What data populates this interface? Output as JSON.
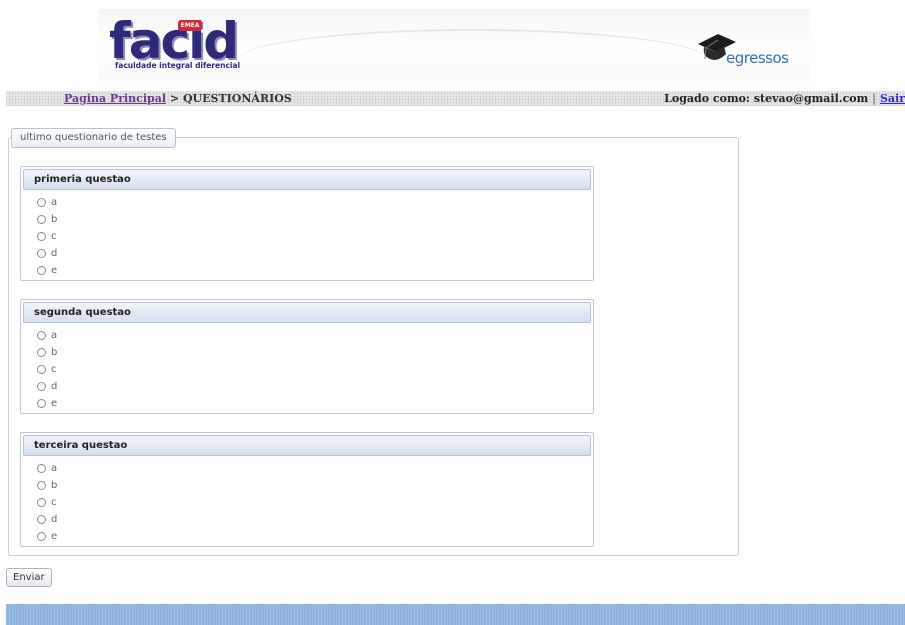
{
  "header": {
    "logo_facid": {
      "word": "facid",
      "badge": "EMEA",
      "tagline": "faculdade integral diferencial"
    },
    "logo_egressos": {
      "word": "egressos"
    }
  },
  "nav": {
    "home_link": "Pagina Principal",
    "separator": " > ",
    "current": "QUESTIONÁRIOS",
    "logged_as": "Logado como: stevao@gmail.com",
    "pipe": " | ",
    "logout_link": "Sair"
  },
  "form": {
    "legend": "ultimo questionario de testes",
    "questions": [
      {
        "title": "primeria questao",
        "options": [
          "a",
          "b",
          "c",
          "d",
          "e"
        ]
      },
      {
        "title": "segunda questao",
        "options": [
          "a",
          "b",
          "c",
          "d",
          "e"
        ]
      },
      {
        "title": "terceira questao",
        "options": [
          "a",
          "b",
          "c",
          "d",
          "e"
        ]
      }
    ],
    "submit_label": "Enviar"
  },
  "colors": {
    "nav_link": "#6a3a8a",
    "logout_link": "#2b2bd6",
    "footer": "#8cb4dc",
    "facid_blue": "#2d2a7a"
  }
}
